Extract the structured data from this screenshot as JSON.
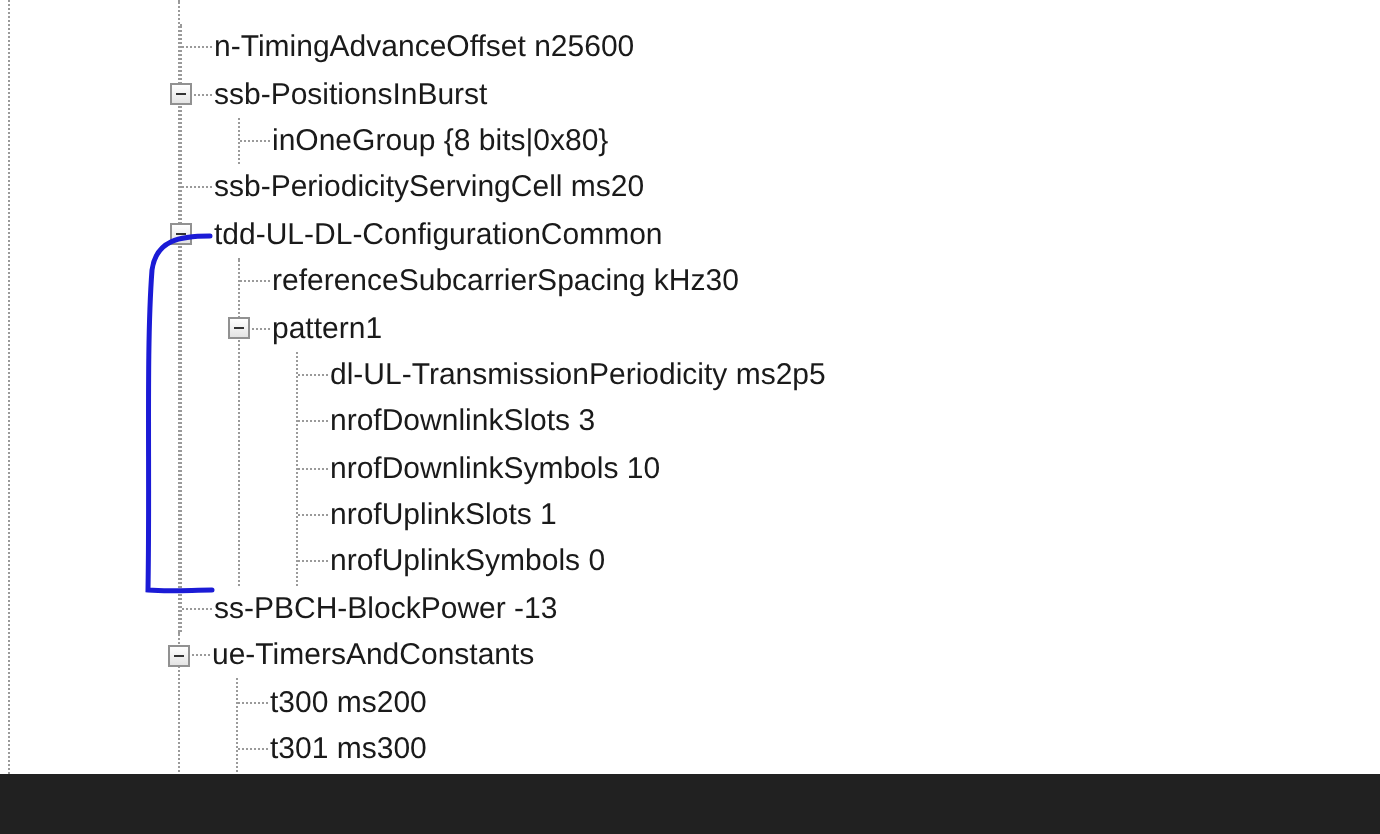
{
  "tree": {
    "upper_branch": [
      {
        "label": "n-TimingAdvanceOffset n25600"
      },
      {
        "label": "ssb-PositionsInBurst",
        "expanded": true,
        "children": [
          {
            "label": "inOneGroup {8 bits|0x80}"
          }
        ]
      },
      {
        "label": "ssb-PeriodicityServingCell ms20"
      },
      {
        "label": "tdd-UL-DL-ConfigurationCommon",
        "expanded": true,
        "children": [
          {
            "label": "referenceSubcarrierSpacing kHz30"
          },
          {
            "label": "pattern1",
            "expanded": true,
            "children": [
              {
                "label": "dl-UL-TransmissionPeriodicity ms2p5"
              },
              {
                "label": "nrofDownlinkSlots 3"
              },
              {
                "label": "nrofDownlinkSymbols 10"
              },
              {
                "label": "nrofUplinkSlots 1"
              },
              {
                "label": "nrofUplinkSymbols 0"
              }
            ]
          }
        ]
      },
      {
        "label": "ss-PBCH-BlockPower -13"
      }
    ],
    "nodes": [
      {
        "label": "ue-TimersAndConstants",
        "expanded": true,
        "children": [
          {
            "label": "t300 ms200"
          },
          {
            "label": "t301 ms300"
          }
        ]
      }
    ]
  }
}
